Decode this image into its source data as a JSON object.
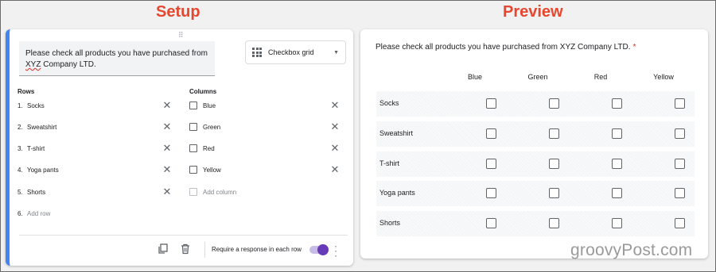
{
  "setup_title": "Setup",
  "preview_title": "Preview",
  "setup": {
    "question_line1": "Please check all products you have purchased from",
    "question_line2_underlined": "XYZ",
    "question_line2_rest": " Company LTD.",
    "type_select_label": "Checkbox grid",
    "rows_header": "Rows",
    "columns_header": "Columns",
    "rows": [
      {
        "num": "1.",
        "label": "Socks"
      },
      {
        "num": "2.",
        "label": "Sweatshirt"
      },
      {
        "num": "3.",
        "label": "T-shirt"
      },
      {
        "num": "4.",
        "label": "Yoga pants"
      },
      {
        "num": "5.",
        "label": "Shorts"
      }
    ],
    "add_row": {
      "num": "6.",
      "label": "Add row"
    },
    "columns": [
      "Blue",
      "Green",
      "Red",
      "Yellow"
    ],
    "add_column_label": "Add column",
    "require_label": "Require a response in each row",
    "require_toggle_on": true,
    "accent_color": "#673ab7",
    "focus_bar_color": "#4285f4"
  },
  "preview": {
    "question": "Please check all products you have purchased from XYZ Company LTD.",
    "required_mark": "*",
    "columns": [
      "Blue",
      "Green",
      "Red",
      "Yellow"
    ],
    "rows": [
      "Socks",
      "Sweatshirt",
      "T-shirt",
      "Yoga pants",
      "Shorts"
    ]
  },
  "watermark": "groovyPost.com",
  "icons": [
    "drag-handle-icon",
    "checkbox-grid-icon",
    "dropdown-caret-icon",
    "close-icon",
    "duplicate-icon",
    "delete-icon",
    "more-vert-icon"
  ]
}
